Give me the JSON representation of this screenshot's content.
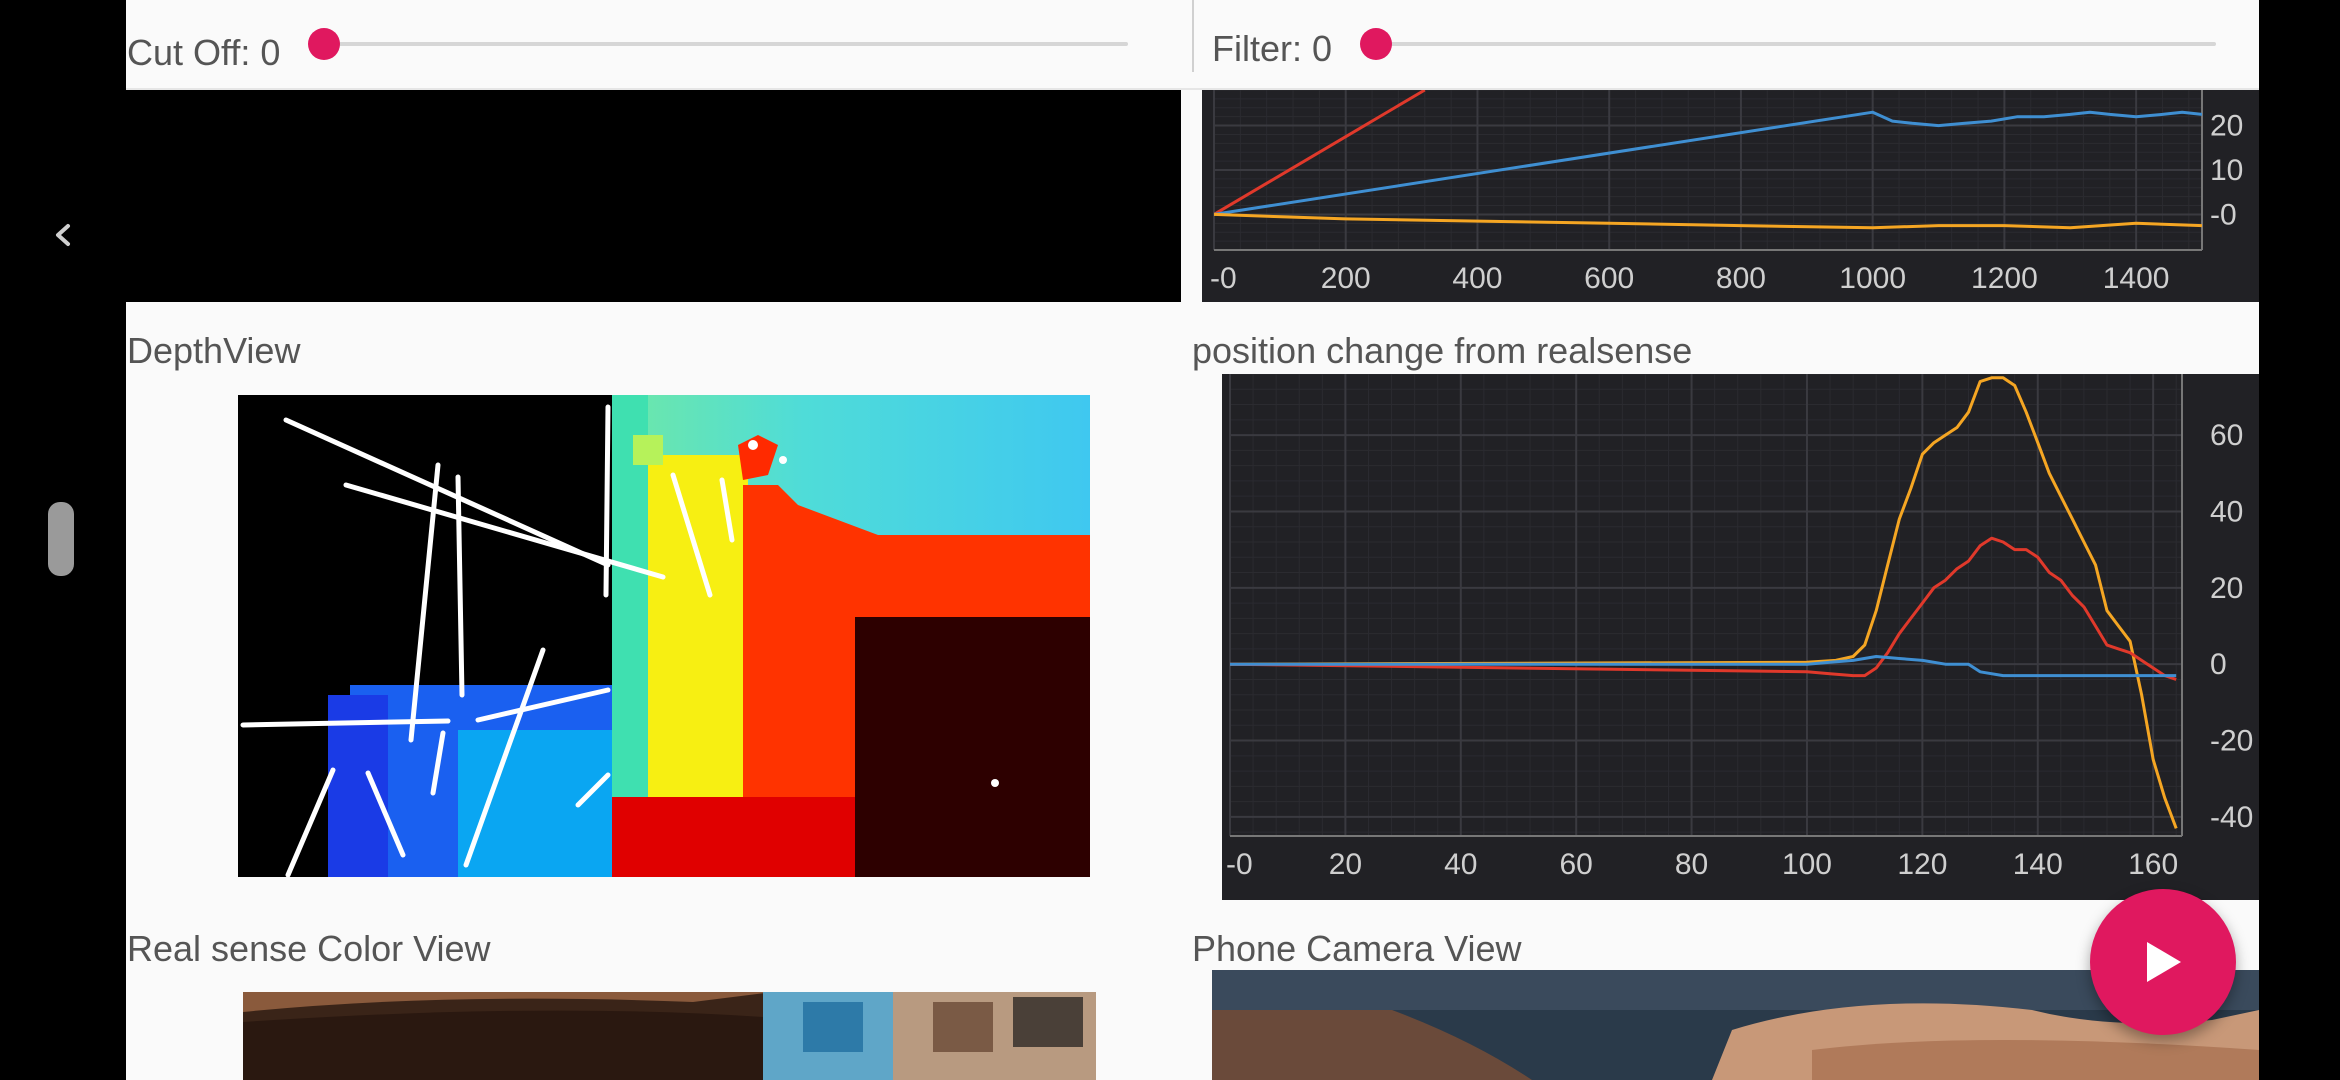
{
  "colors": {
    "accent": "#e0185f",
    "chart_bg": "#212125",
    "series_blue": "#3f8fd2",
    "series_red": "#e0392b",
    "series_orange": "#f5a623"
  },
  "controls": {
    "cutoff": {
      "label": "Cut Off: 0",
      "value": 0
    },
    "filter": {
      "label": "Filter: 0",
      "value": 0
    }
  },
  "sections": {
    "depth_view": "DepthView",
    "position_change": "position change from realsense",
    "realsense_color": "Real sense Color View",
    "phone_camera": "Phone Camera View"
  },
  "icons": {
    "back": "chevron-left-icon",
    "play": "play-icon"
  },
  "chart_data": [
    {
      "type": "line",
      "title": "",
      "xlim": [
        0,
        1500
      ],
      "ylim": [
        -8,
        28
      ],
      "xticks": [
        "-0",
        "200",
        "400",
        "600",
        "800",
        "1000",
        "1200",
        "1400"
      ],
      "yticks": [
        "20",
        "10",
        "-0"
      ],
      "series": [
        {
          "color": "#e0392b",
          "x": [
            0,
            320
          ],
          "y": [
            0,
            28
          ]
        },
        {
          "color": "#3f8fd2",
          "x": [
            0,
            1000,
            1030,
            1060,
            1100,
            1140,
            1180,
            1220,
            1260,
            1300,
            1330,
            1360,
            1400,
            1440,
            1470,
            1500
          ],
          "y": [
            0,
            23,
            21,
            20.5,
            20,
            20.5,
            21,
            22,
            22,
            22.5,
            23,
            22.5,
            22,
            22.5,
            23,
            22.5
          ]
        },
        {
          "color": "#f5a623",
          "x": [
            0,
            200,
            400,
            600,
            800,
            1000,
            1100,
            1200,
            1300,
            1400,
            1500
          ],
          "y": [
            0,
            -1,
            -1.5,
            -2,
            -2.5,
            -3,
            -2.5,
            -2.5,
            -3,
            -2,
            -2.5
          ]
        }
      ]
    },
    {
      "type": "line",
      "title": "position change from realsense",
      "xlim": [
        0,
        165
      ],
      "ylim": [
        -45,
        76
      ],
      "xticks": [
        "-0",
        "20",
        "40",
        "60",
        "80",
        "100",
        "120",
        "140",
        "160"
      ],
      "yticks": [
        "60",
        "40",
        "20",
        "0",
        "-20",
        "-40"
      ],
      "series": [
        {
          "color": "#f5a623",
          "x": [
            0,
            100,
            105,
            108,
            110,
            112,
            114,
            116,
            118,
            120,
            122,
            124,
            126,
            128,
            130,
            132,
            134,
            136,
            138,
            140,
            142,
            144,
            146,
            148,
            150,
            152,
            154,
            156,
            158,
            160,
            162,
            164
          ],
          "y": [
            0,
            0.5,
            1,
            2,
            5,
            14,
            26,
            38,
            46,
            55,
            58,
            60,
            62,
            66,
            74,
            75,
            75,
            73,
            66,
            58,
            50,
            44,
            38,
            32,
            26,
            14,
            10,
            6,
            -8,
            -25,
            -35,
            -43
          ]
        },
        {
          "color": "#e0392b",
          "x": [
            0,
            100,
            104,
            108,
            110,
            112,
            114,
            116,
            118,
            120,
            122,
            124,
            126,
            128,
            130,
            132,
            134,
            136,
            138,
            140,
            142,
            144,
            146,
            148,
            150,
            152,
            154,
            156,
            158,
            160,
            162,
            164
          ],
          "y": [
            0,
            -2,
            -2.5,
            -3,
            -3,
            -1,
            3,
            8,
            12,
            16,
            20,
            22,
            25,
            27,
            31,
            33,
            32,
            30,
            30,
            28,
            24,
            22,
            18,
            15,
            10,
            5,
            4,
            3,
            1,
            -1,
            -3,
            -4
          ]
        },
        {
          "color": "#3f8fd2",
          "x": [
            0,
            100,
            104,
            108,
            112,
            116,
            120,
            124,
            128,
            130,
            134,
            138,
            142,
            146,
            150,
            156,
            160,
            164
          ],
          "y": [
            0,
            0,
            0.5,
            1,
            2,
            1.5,
            1,
            0,
            0,
            -2,
            -3,
            -3,
            -3,
            -3,
            -3,
            -3,
            -3,
            -3
          ]
        }
      ]
    }
  ]
}
